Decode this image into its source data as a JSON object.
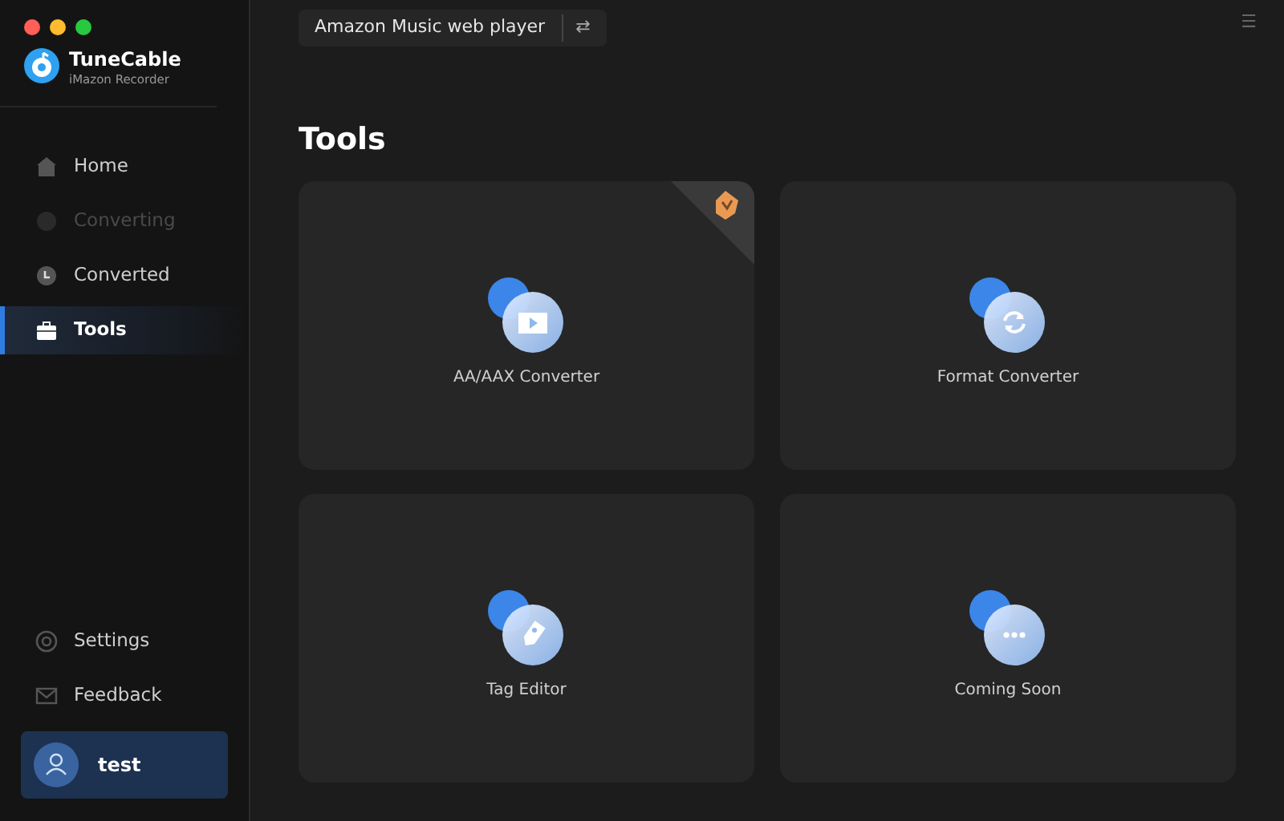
{
  "window": {
    "controls": [
      {
        "color": "#ff5f57"
      },
      {
        "color": "#febc2e"
      },
      {
        "color": "#28c840"
      }
    ]
  },
  "brand": {
    "name": "TuneCable",
    "subtitle": "iMazon Recorder"
  },
  "source_selector": {
    "label": "Amazon Music web player",
    "icon": "⇄"
  },
  "menu_icon": "☰",
  "nav": [
    {
      "label": "Home",
      "kind": "home",
      "selected": false,
      "disabled": false
    },
    {
      "label": "Converting",
      "kind": "converting",
      "selected": false,
      "disabled": true
    },
    {
      "label": "Converted",
      "kind": "converted",
      "selected": false,
      "disabled": false
    },
    {
      "label": "Tools",
      "kind": "tools",
      "selected": true,
      "disabled": false
    }
  ],
  "bottom_nav": [
    {
      "label": "Settings",
      "kind": "settings"
    },
    {
      "label": "Feedback",
      "kind": "feedback"
    }
  ],
  "user": {
    "name": "test"
  },
  "page_title": "Tools",
  "tools": [
    {
      "label": "AA/AAX Converter",
      "kind": "video",
      "premium": true
    },
    {
      "label": "Format Converter",
      "kind": "sync",
      "premium": false
    },
    {
      "label": "Tag Editor",
      "kind": "tag",
      "premium": false
    },
    {
      "label": "Coming Soon",
      "kind": "more",
      "premium": false
    }
  ]
}
